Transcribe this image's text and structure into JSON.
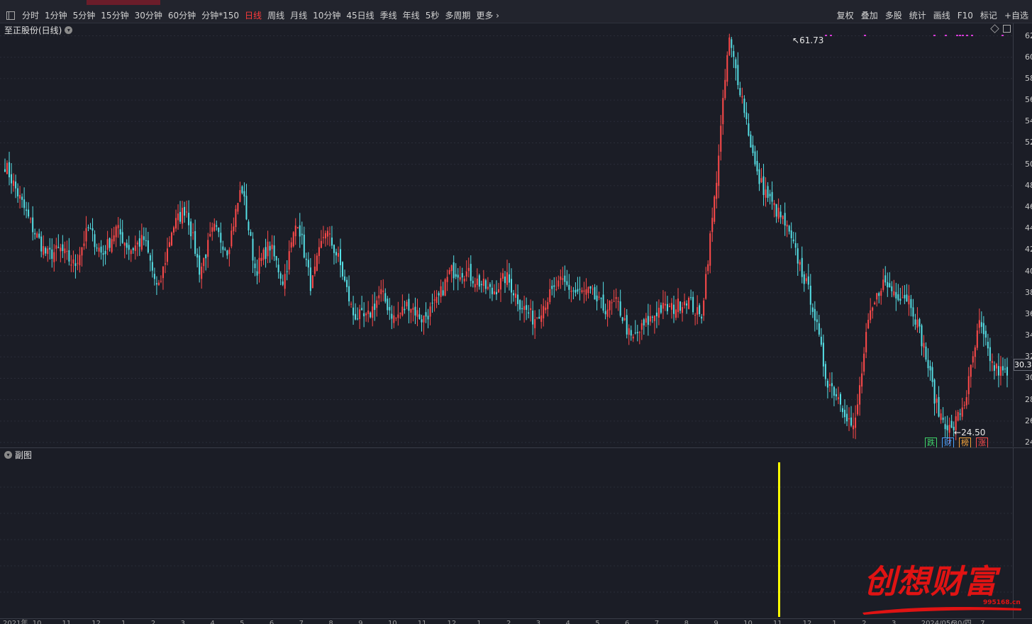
{
  "toolbar": {
    "periods": [
      "分时",
      "1分钟",
      "5分钟",
      "15分钟",
      "30分钟",
      "60分钟",
      "分钟*150",
      "日线",
      "周线",
      "月线",
      "10分钟",
      "45日线",
      "季线",
      "年线",
      "5秒",
      "多周期",
      "更多"
    ],
    "active_period": "日线",
    "more_suffix": "›",
    "tools": [
      "复权",
      "叠加",
      "多股",
      "统计",
      "画线",
      "F10",
      "标记",
      "+自选"
    ]
  },
  "main_chart": {
    "title": "至正股份(日线)",
    "high_label": "61.73",
    "low_label": "24.50",
    "current_price": "30.3",
    "price_axis_labels": [
      "62",
      "60",
      "58",
      "56",
      "54",
      "52",
      "50",
      "48",
      "46",
      "44",
      "42",
      "40",
      "38",
      "36",
      "34",
      "32",
      "30",
      "28",
      "26",
      "24"
    ],
    "tags": [
      "跌",
      "财",
      "榜",
      "涨"
    ]
  },
  "sub_chart": {
    "title": "副图"
  },
  "date_axis": {
    "labels": [
      "2021年",
      "10",
      "11",
      "12",
      "1",
      "2",
      "3",
      "4",
      "5",
      "6",
      "7",
      "8",
      "9",
      "10",
      "11",
      "12",
      "1",
      "2",
      "3",
      "4",
      "5",
      "6",
      "7",
      "8",
      "9",
      "10",
      "11",
      "12",
      "1",
      "2",
      "3",
      "2024/05/30/四",
      "6",
      "7"
    ]
  },
  "watermark": {
    "text": "创想财富",
    "domain": "995168.cn"
  },
  "chart_data": {
    "type": "candlestick",
    "title": "至正股份(日线)",
    "y_range": [
      24,
      62.5
    ],
    "high": 61.73,
    "low": 24.5,
    "last": 30.3,
    "approx_close_path": [
      50,
      47,
      44,
      41.5,
      42,
      40.5,
      44,
      41.5,
      44,
      42,
      43,
      38,
      44,
      46,
      40,
      44,
      42,
      48,
      40,
      42.5,
      39,
      45,
      38.5,
      44,
      41,
      36,
      35.5,
      38,
      35.5,
      37,
      35.5,
      37,
      40,
      40,
      39,
      38,
      39.5,
      37,
      35.5,
      37.5,
      39,
      38,
      38,
      36.5,
      37,
      33.5,
      35,
      36.5,
      36.5,
      37.5,
      35.5,
      47,
      61.7,
      56,
      49,
      46.5,
      44.5,
      41,
      37,
      30,
      28,
      25,
      35,
      39,
      38,
      37.5,
      33,
      27,
      25,
      28,
      35,
      31,
      30.3
    ]
  },
  "colors": {
    "up": "#ff4a4a",
    "down": "#55dfe5",
    "volume_marker": "#ffff00",
    "accent": "#ff3b3b",
    "signal": "#d63bd6"
  }
}
